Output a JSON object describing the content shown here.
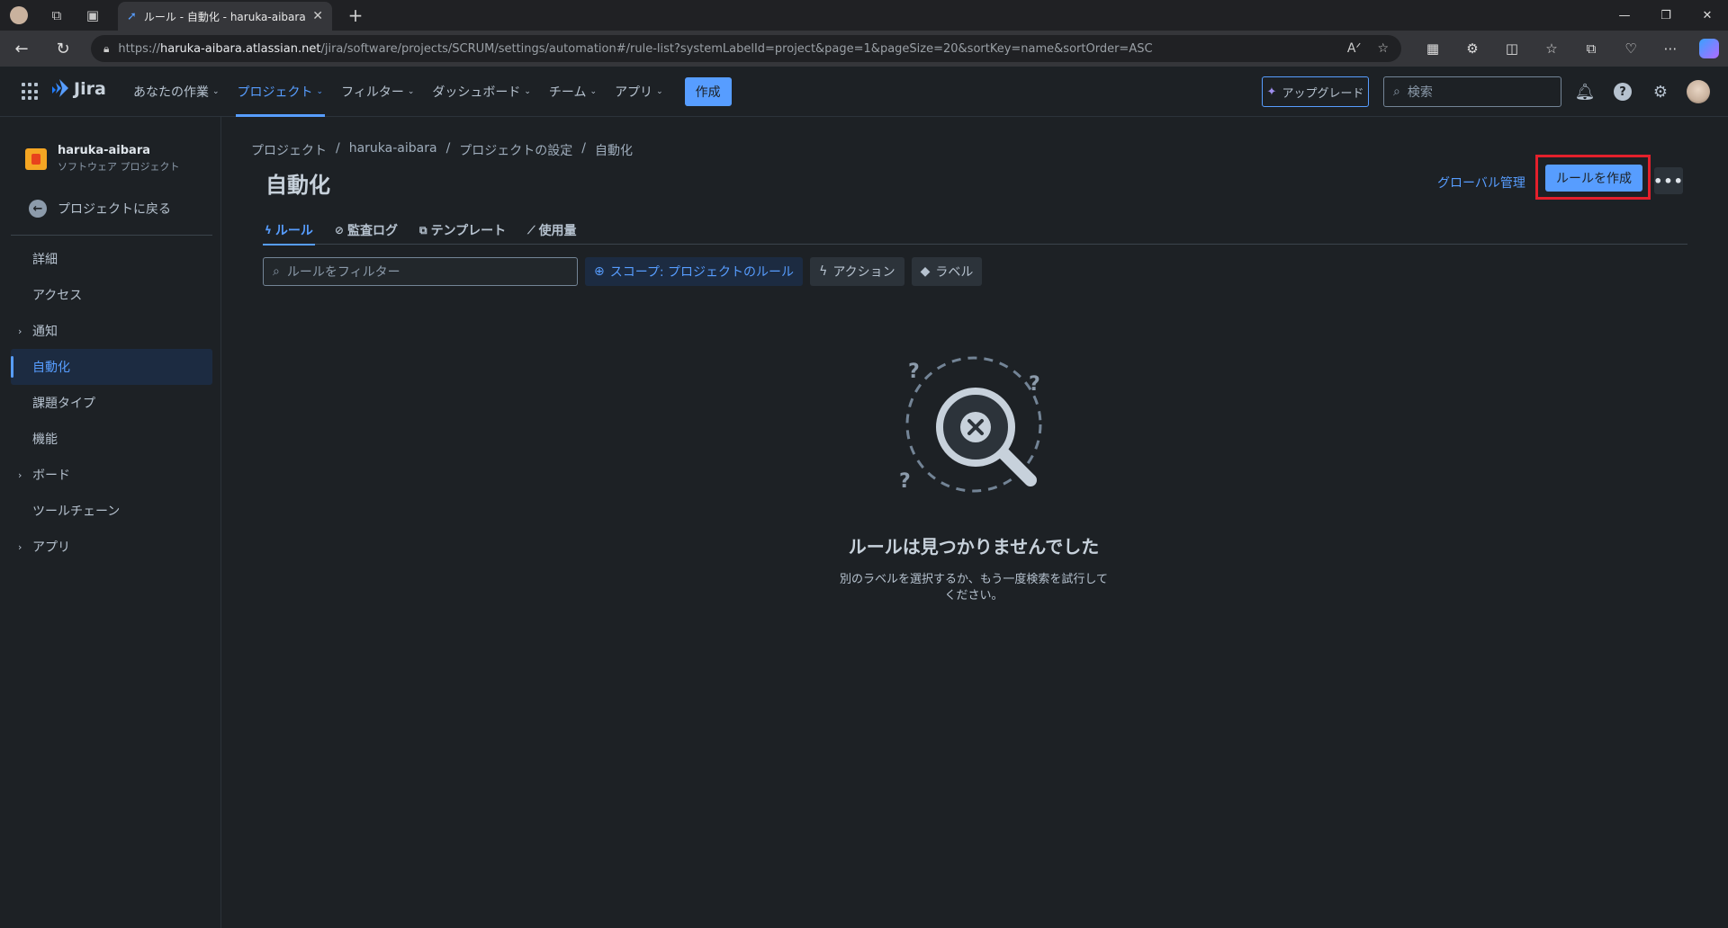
{
  "browser": {
    "tab_title": "ルール - 自動化 - haruka-aibara - Jira",
    "url_prefix": "https://",
    "url_host": "haruka-aibara.atlassian.net",
    "url_path": "/jira/software/projects/SCRUM/settings/automation#/rule-list?systemLabelId=project&page=1&pageSize=20&sortKey=name&sortOrder=ASC"
  },
  "topnav": {
    "product": "Jira",
    "items": [
      {
        "label": "あなたの作業"
      },
      {
        "label": "プロジェクト"
      },
      {
        "label": "フィルター"
      },
      {
        "label": "ダッシュボード"
      },
      {
        "label": "チーム"
      },
      {
        "label": "アプリ"
      }
    ],
    "create_label": "作成",
    "upgrade_label": "アップグレード",
    "search_placeholder": "検索"
  },
  "sidebar": {
    "project_name": "haruka-aibara",
    "project_type": "ソフトウェア プロジェクト",
    "back_label": "プロジェクトに戻る",
    "items": [
      {
        "label": "詳細"
      },
      {
        "label": "アクセス"
      },
      {
        "label": "通知"
      },
      {
        "label": "自動化"
      },
      {
        "label": "課題タイプ"
      },
      {
        "label": "機能"
      },
      {
        "label": "ボード"
      },
      {
        "label": "ツールチェーン"
      },
      {
        "label": "アプリ"
      }
    ]
  },
  "main": {
    "breadcrumb": [
      "プロジェクト",
      "haruka-aibara",
      "プロジェクトの設定",
      "自動化"
    ],
    "breadcrumb_sep": "/",
    "title": "自動化",
    "global_admin_label": "グローバル管理",
    "create_rule_label": "ルールを作成",
    "more_label": "•••",
    "tabs": [
      {
        "label": "ルール"
      },
      {
        "label": "監査ログ"
      },
      {
        "label": "テンプレート"
      },
      {
        "label": "使用量"
      }
    ],
    "filter_placeholder": "ルールをフィルター",
    "scope_chip": "スコープ: プロジェクトのルール",
    "action_chip": "アクション",
    "label_chip": "ラベル",
    "empty_title": "ルールは見つかりませんでした",
    "empty_desc": "別のラベルを選択するか、もう一度検索を試行してください。"
  },
  "colors": {
    "accent": "#579dff",
    "highlight_box": "#e3202c",
    "background": "#1d2125"
  }
}
